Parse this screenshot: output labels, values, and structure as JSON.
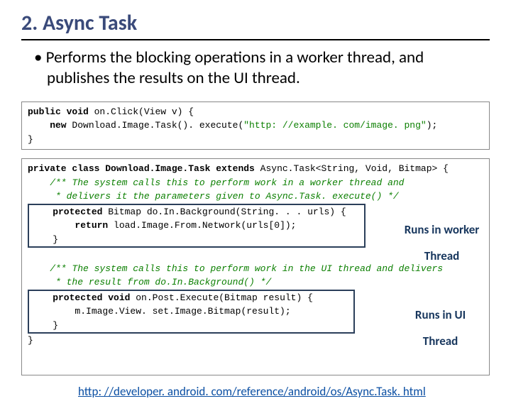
{
  "title": "2. Async Task",
  "bullet": "Performs the blocking operations in a worker thread, and publishes the results on the UI thread.",
  "code1": {
    "l1a": "public void",
    "l1b": " on.Click(View v) {",
    "l2a": "    new",
    "l2b": " Download.Image.Task(). execute(",
    "l2c": "\"http: //example. com/image. png\"",
    "l2d": ");",
    "l3": "}"
  },
  "code2": {
    "l1a": "private class ",
    "l1b": "Download.Image.Task ",
    "l1c": "extends ",
    "l1d": "Async.Task<String, Void, Bitmap> {",
    "c1": "    /** The system calls this to perform work in a worker thread and",
    "c2": "     * delivers it the parameters given to Async.Task. execute() */",
    "h1a": "    protected ",
    "h1b": "Bitmap do.In.Background(String. . . urls) {",
    "h1c": "        return ",
    "h1d": "load.Image.From.Network(urls[0]);",
    "h1e": "    }",
    "c3": "    /** The system calls this to perform work in the UI thread and delivers",
    "c4": "     * the result from do.In.Background() */",
    "h2a": "    protected void ",
    "h2b": "on.Post.Execute(Bitmap result) {",
    "h2c": "        m.Image.View. set.Image.Bitmap(result);",
    "h2d": "    }",
    "l9": "}"
  },
  "annot1a": "Runs in worker",
  "annot1b": "Thread",
  "annot2a": "Runs in UI",
  "annot2b": "Thread",
  "link": "http: //developer. android. com/reference/android/os/Async.Task. html"
}
